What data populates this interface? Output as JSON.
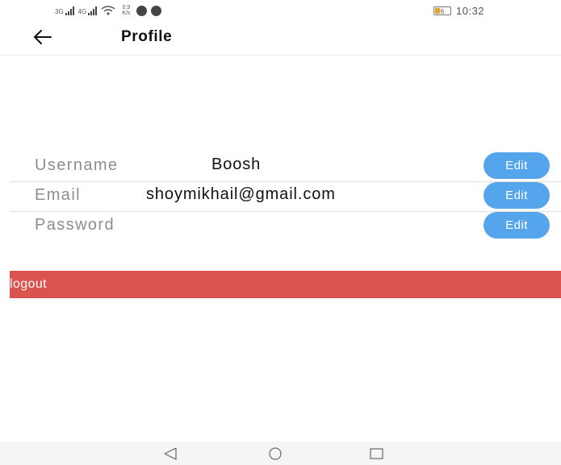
{
  "status_bar": {
    "signal_1": "3G",
    "signal_2": "4G",
    "net_speed_value": "0.9",
    "net_speed_unit": "K/s",
    "battery": "6",
    "time": "10:32",
    "icons": [
      "signal-icon",
      "wifi-icon",
      "notification-icon",
      "battery-icon"
    ]
  },
  "header": {
    "title": "Profile",
    "back_icon": "arrow-left-icon"
  },
  "profile": {
    "rows": [
      {
        "label": "Username",
        "value": "Boosh",
        "button": "Edit"
      },
      {
        "label": "Email",
        "value": "shoymikhail@gmail.com",
        "button": "Edit"
      },
      {
        "label": "Password",
        "value": "",
        "button": "Edit"
      }
    ]
  },
  "logout": {
    "label": "logout"
  },
  "nav_bar": {
    "icons": [
      "back-triangle-icon",
      "home-circle-icon",
      "recents-square-icon"
    ]
  },
  "colors": {
    "edit_button": "#55a5ec",
    "logout_bar": "#d9534f",
    "label_text": "#8d8d8d"
  }
}
